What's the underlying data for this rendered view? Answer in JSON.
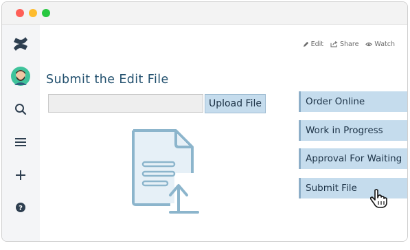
{
  "window": {
    "controls": [
      "close",
      "minimize",
      "maximize"
    ]
  },
  "sidebar": {
    "items": [
      {
        "name": "confluence-logo-icon"
      },
      {
        "name": "avatar"
      },
      {
        "name": "search-icon"
      },
      {
        "name": "menu-icon"
      },
      {
        "name": "plus-icon"
      },
      {
        "name": "help-icon"
      }
    ]
  },
  "header": {
    "actions": [
      {
        "label": "Edit",
        "icon": "pencil-icon"
      },
      {
        "label": "Share",
        "icon": "share-icon"
      },
      {
        "label": "Watch",
        "icon": "eye-icon"
      }
    ]
  },
  "main": {
    "title": "Submit the Edit File",
    "upload": {
      "input_value": "",
      "button_label": "Upload File"
    }
  },
  "steps": [
    {
      "label": "Order Online"
    },
    {
      "label": "Work in Progress"
    },
    {
      "label": "Approval For Waiting"
    },
    {
      "label": "Submit File"
    }
  ],
  "colors": {
    "accent": "#c5dced",
    "accent_border": "#8daec8",
    "title": "#22506e",
    "icon_stroke": "#8cb5cc",
    "icon_fill": "#e6f0f7"
  }
}
